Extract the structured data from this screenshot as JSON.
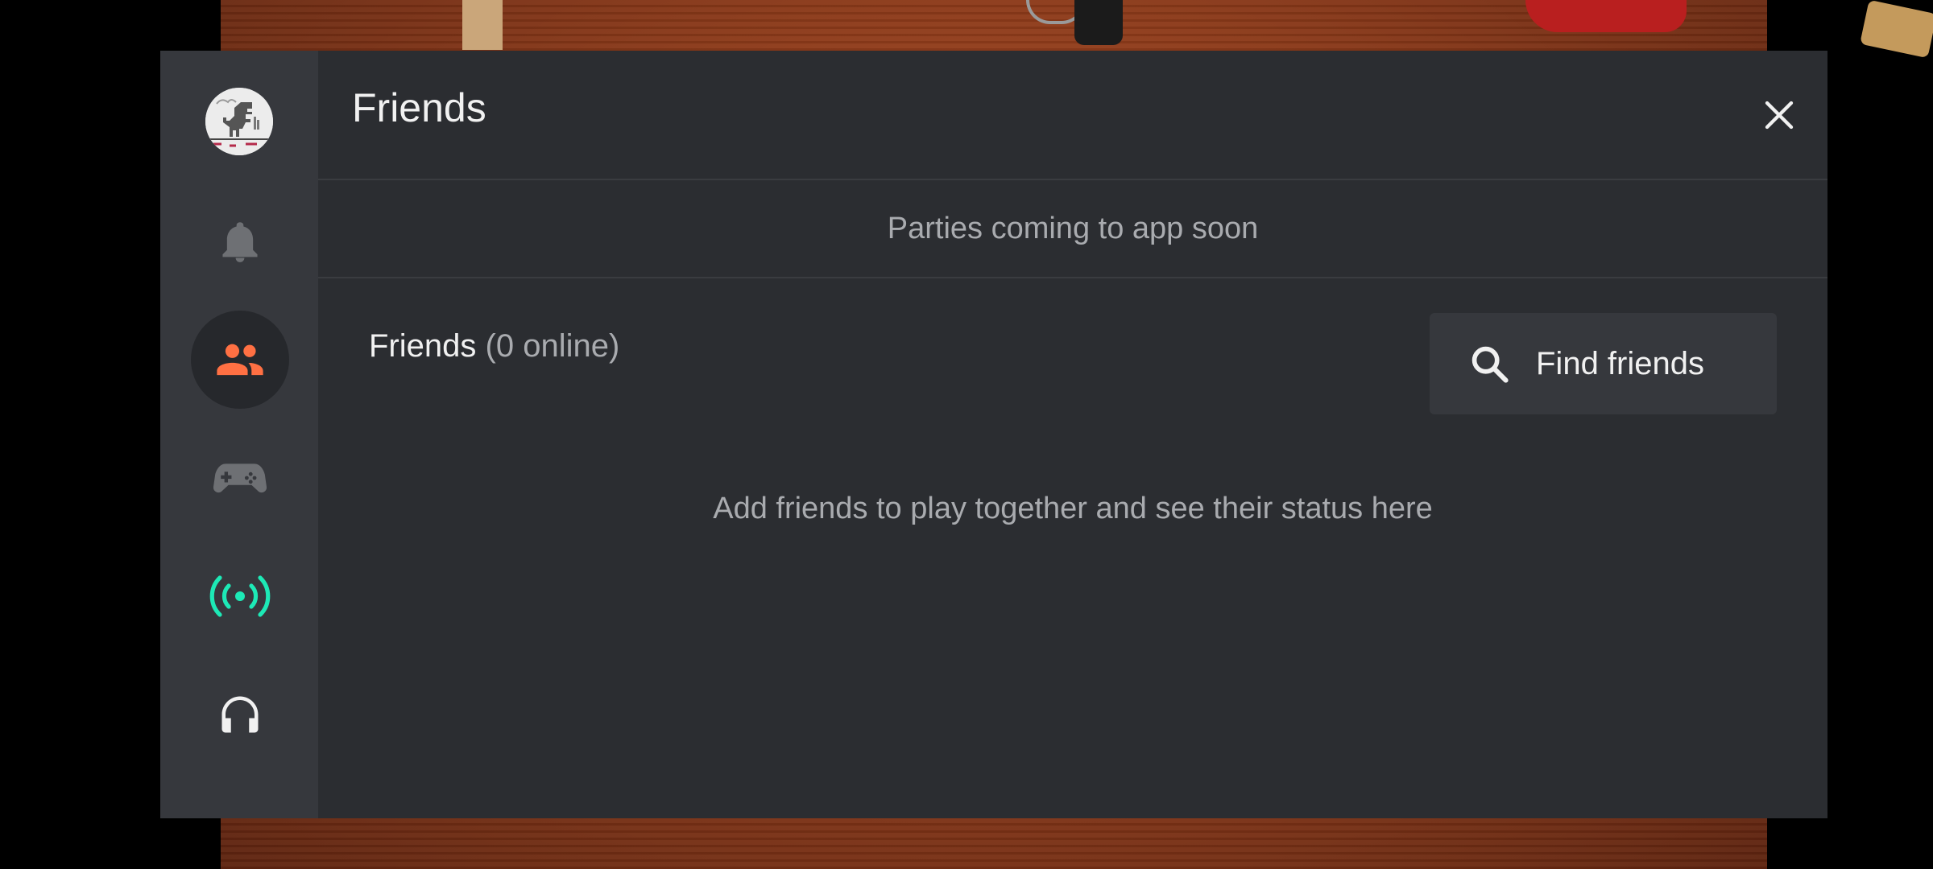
{
  "overlay": {
    "title": "Friends",
    "notice": "Parties coming to app soon",
    "friends_section": {
      "label": "Friends",
      "online_count": "(0 online)"
    },
    "find_friends_label": "Find friends",
    "empty_message": "Add friends to play together and see their status here"
  },
  "sidebar": {
    "items": [
      {
        "name": "avatar",
        "icon": "dino-avatar"
      },
      {
        "name": "notifications",
        "icon": "bell-icon"
      },
      {
        "name": "friends",
        "icon": "people-icon",
        "active": true
      },
      {
        "name": "games",
        "icon": "gamepad-icon"
      },
      {
        "name": "live",
        "icon": "broadcast-icon"
      },
      {
        "name": "audio",
        "icon": "headphones-icon"
      }
    ]
  },
  "colors": {
    "panel_bg": "#2b2d31",
    "rail_bg": "#36383d",
    "accent_orange": "#ff7043",
    "accent_teal": "#1de9b6",
    "text_primary": "#f1f1f1",
    "text_secondary": "#a9abaf"
  }
}
